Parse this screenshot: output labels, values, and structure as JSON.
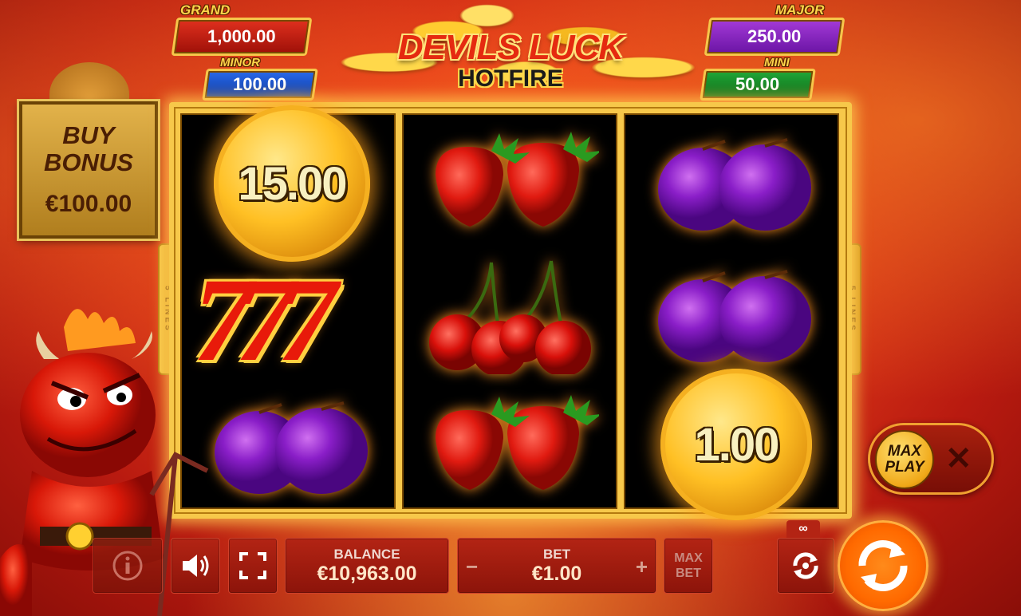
{
  "jackpots": {
    "grand": {
      "label": "GRAND",
      "value": "1,000.00"
    },
    "minor": {
      "label": "MINOR",
      "value": "100.00"
    },
    "major": {
      "label": "MAJOR",
      "value": "250.00"
    },
    "mini": {
      "label": "MINI",
      "value": "50.00"
    }
  },
  "title": {
    "main": "DEVILS LUCK",
    "sub": "HOTFIRE"
  },
  "buy_bonus": {
    "line1": "BUY",
    "line2": "BONUS",
    "price": "€100.00"
  },
  "lines_label": "5 LINES",
  "reels": {
    "reel1": [
      "coin",
      "seven",
      "plum"
    ],
    "reel2": [
      "strawberry",
      "cherry",
      "strawberry"
    ],
    "reel3": [
      "plum",
      "plum",
      "coin"
    ]
  },
  "coin_values": {
    "reel1_top": "15.00",
    "reel3_bottom": "1.00"
  },
  "seven_text": "777",
  "controls": {
    "balance_label": "BALANCE",
    "balance_value": "€10,963.00",
    "bet_label": "BET",
    "bet_value": "€1.00",
    "bet_minus": "−",
    "bet_plus": "+",
    "maxbet_line1": "MAX",
    "maxbet_line2": "BET",
    "autoplay_count": "∞"
  },
  "maxplay": {
    "line1": "MAX",
    "line2": "PLAY",
    "close": "✕"
  },
  "colors": {
    "accent": "#f7c84a",
    "background": "#e8401a",
    "spin": "#ff6a00"
  }
}
